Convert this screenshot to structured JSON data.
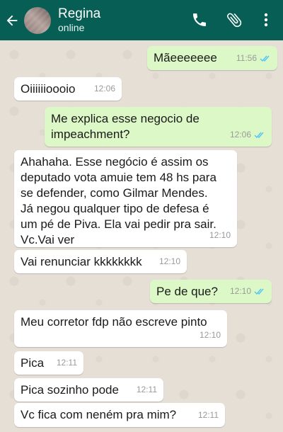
{
  "header": {
    "contact_name": "Regina",
    "contact_status": "online",
    "colors": {
      "bar": "#075e54"
    }
  },
  "messages": [
    {
      "direction": "out",
      "text": "Mãeeeeeee",
      "time": "11:56",
      "read": true
    },
    {
      "direction": "in",
      "text": "Oiiiiiioooio",
      "time": "12:06"
    },
    {
      "direction": "out",
      "text": "Me explica esse negocio de\nimpeachment?",
      "time": "12:06",
      "read": true
    },
    {
      "direction": "in",
      "text": "Ahahaha. Esse negócio é  assim os\ndeputado vota amuie tem 48 hs para\nse defender, como Gilmar Mendes.\nJá negou qualquer tipo de defesa é\num pé de Piva. Ela vai pedir pra sair.\nVc.Vai ver",
      "time": "12:10"
    },
    {
      "direction": "in",
      "text": "Vai renunciar kkkkkkkk",
      "time": "12:10"
    },
    {
      "direction": "out",
      "text": "Pe de que?",
      "time": "12:10",
      "read": true
    },
    {
      "direction": "in",
      "text": "Meu corretor fdp não escreve pinto",
      "time": "12:10"
    },
    {
      "direction": "in",
      "text": "Pica",
      "time": "12:11"
    },
    {
      "direction": "in",
      "text": "Pica sozinho pode",
      "time": "12:11"
    },
    {
      "direction": "in",
      "text": "Vc fica com neném pra mim?",
      "time": "12:11"
    }
  ],
  "icons": {
    "back": "arrow-back-icon",
    "call": "phone-icon",
    "attach": "paperclip-icon",
    "menu": "more-vertical-icon",
    "read_receipt": "double-check-icon"
  },
  "colors": {
    "outgoing_bubble": "#dcf8c6",
    "incoming_bubble": "#ffffff",
    "read_tick": "#4fc3f7"
  }
}
